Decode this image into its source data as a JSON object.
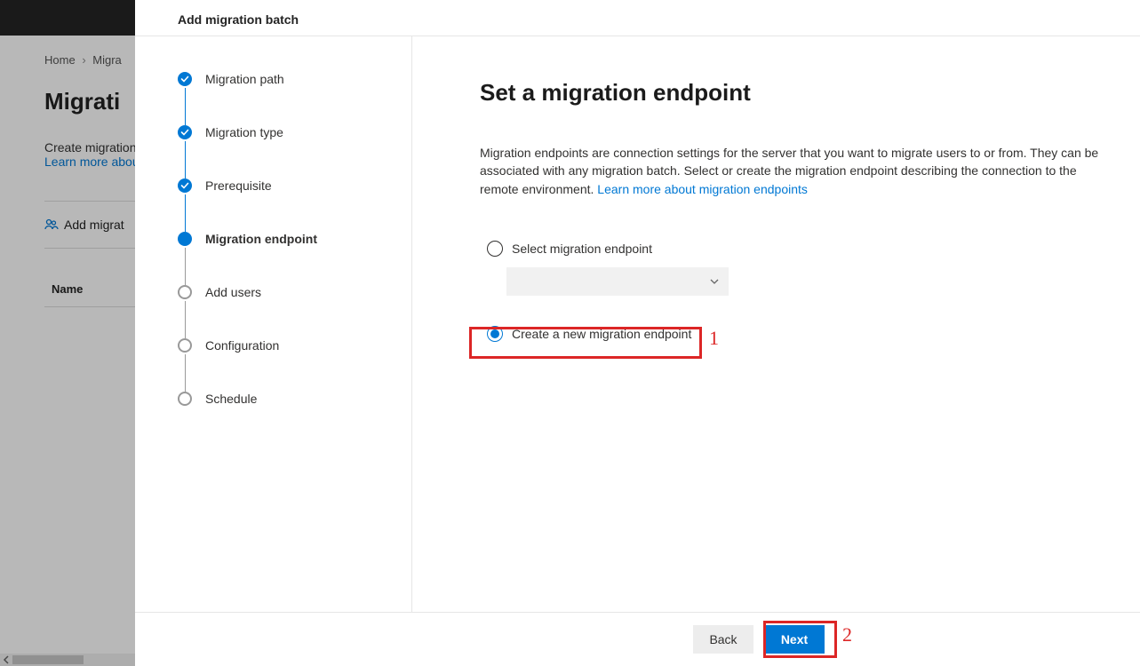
{
  "bg": {
    "breadcrumb": {
      "home": "Home",
      "current": "Migra"
    },
    "title": "Migrati",
    "subtext": "Create migration",
    "link": "Learn more abou",
    "add_btn": "Add migrat",
    "col_name": "Name"
  },
  "panel": {
    "header": "Add migration batch",
    "steps": [
      {
        "label": "Migration path",
        "state": "complete"
      },
      {
        "label": "Migration type",
        "state": "complete"
      },
      {
        "label": "Prerequisite",
        "state": "complete"
      },
      {
        "label": "Migration endpoint",
        "state": "current"
      },
      {
        "label": "Add users",
        "state": "future"
      },
      {
        "label": "Configuration",
        "state": "future"
      },
      {
        "label": "Schedule",
        "state": "future"
      }
    ],
    "content": {
      "title": "Set a migration endpoint",
      "desc": "Migration endpoints are connection settings for the server that you want to migrate users to or from. They can be associated with any migration batch. Select or create the migration endpoint describing the connection to the remote environment. ",
      "link": "Learn more about migration endpoints",
      "radio_select": "Select migration endpoint",
      "radio_create": "Create a new migration endpoint"
    },
    "footer": {
      "back": "Back",
      "next": "Next"
    }
  },
  "annotations": {
    "one": "1",
    "two": "2"
  }
}
